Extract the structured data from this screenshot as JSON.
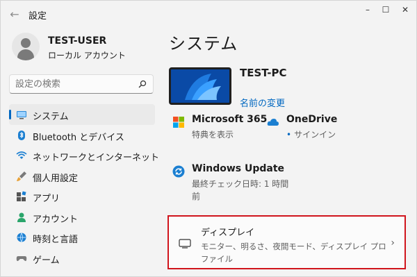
{
  "window": {
    "title": "設定",
    "controls": [
      "–",
      "☐",
      "✕"
    ]
  },
  "profile": {
    "name": "TEST-USER",
    "account_type": "ローカル アカウント"
  },
  "search": {
    "placeholder": "設定の検索"
  },
  "sidebar": {
    "items": [
      {
        "label": "システム",
        "icon": "system-icon",
        "active": true
      },
      {
        "label": "Bluetooth とデバイス",
        "icon": "bluetooth-icon",
        "active": false
      },
      {
        "label": "ネットワークとインターネット",
        "icon": "wifi-icon",
        "active": false
      },
      {
        "label": "個人用設定",
        "icon": "brush-icon",
        "active": false
      },
      {
        "label": "アプリ",
        "icon": "apps-icon",
        "active": false
      },
      {
        "label": "アカウント",
        "icon": "account-icon",
        "active": false
      },
      {
        "label": "時刻と言語",
        "icon": "time-language-icon",
        "active": false
      },
      {
        "label": "ゲーム",
        "icon": "game-icon",
        "active": false
      }
    ]
  },
  "main": {
    "title": "システム",
    "device": {
      "name": "TEST-PC",
      "rename_link": "名前の変更"
    },
    "tiles": {
      "ms365": {
        "title": "Microsoft 365",
        "subtitle": "特典を表示"
      },
      "onedrive": {
        "title": "OneDrive",
        "subtitle": "サインイン"
      },
      "windows_update": {
        "title": "Windows Update",
        "subtitle": "最終チェック日時: 1 時間前"
      }
    },
    "display_card": {
      "title": "ディスプレイ",
      "subtitle": "モニター、明るさ、夜間モード、ディスプレイ プロファイル"
    }
  },
  "colors": {
    "accent": "#0067c0",
    "highlight_border": "#d0141c",
    "background": "#f3f3f3"
  }
}
